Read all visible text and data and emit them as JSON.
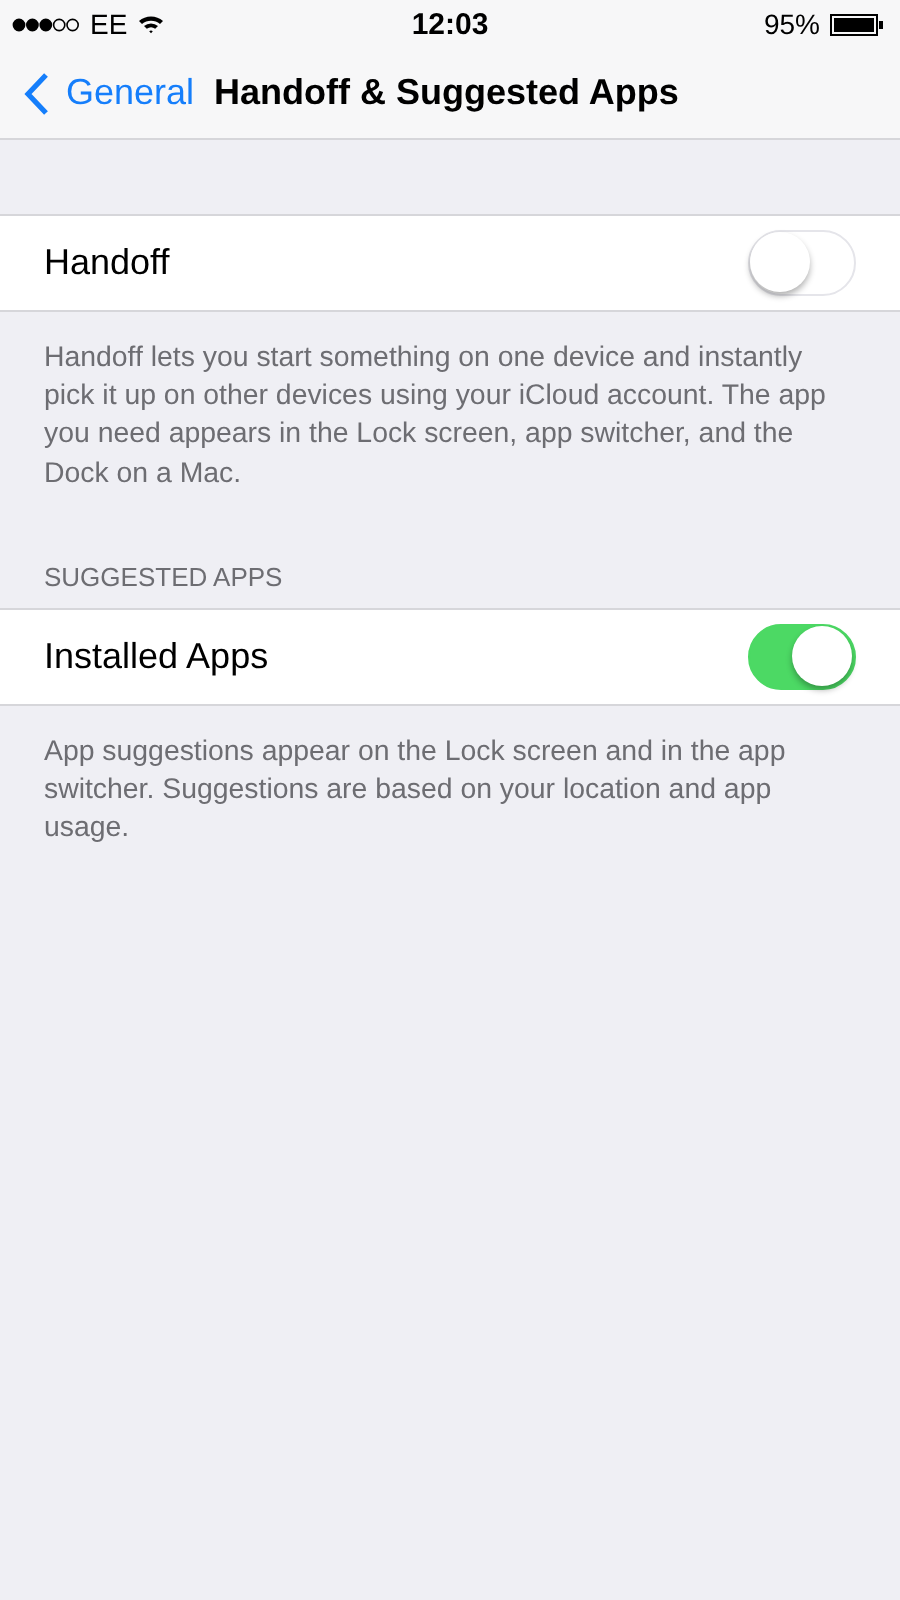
{
  "status_bar": {
    "carrier": "EE",
    "time": "12:03",
    "battery": "95%"
  },
  "nav": {
    "back": "General",
    "title": "Handoff & Suggested Apps"
  },
  "sections": [
    {
      "rows": [
        {
          "label": "Handoff",
          "on": false
        }
      ],
      "footer": "Handoff lets you start something on one device and instantly pick it up on other devices using your iCloud account. The app you need appears in the Lock screen, app switcher, and the Dock on a Mac."
    },
    {
      "header": "SUGGESTED APPS",
      "rows": [
        {
          "label": "Installed Apps",
          "on": true
        }
      ],
      "footer": "App suggestions appear on the Lock screen and in the app switcher. Suggestions are based on your location and app usage."
    }
  ]
}
